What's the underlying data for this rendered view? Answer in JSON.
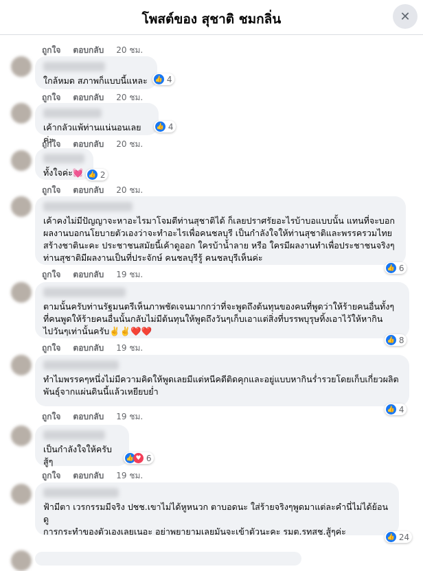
{
  "header": {
    "title": "โพสต์ของ สุชาติ ชมกลิ่น",
    "close_icon": "close-icon"
  },
  "actions": {
    "like_label": "ถูกใจ",
    "reply_label": "ตอบกลับ"
  },
  "top_row": {
    "time": "20 ชม."
  },
  "comments": [
    {
      "text": "ใกล้หมด สภาพก็แบบนี้แหละ",
      "reactions": "4",
      "time": "20 ชม."
    },
    {
      "text": "เค้ากลัวแพ้ท่านแน่นอนเลยค่ะ",
      "reactions": "4",
      "time": "20 ชม."
    },
    {
      "text": "ทั้งใจค่ะ💓",
      "reactions": "2",
      "time": "20 ชม."
    },
    {
      "text": "เค้าคงไม่มีปัญญาจะหาอะไรมาโจมตีท่านสุชาติได้ ก็เลยปราศรัยอะไรบ้าบอแบบนั้น แทนที่จะบอก\nผลงานบอกนโยบายตัวเองว่าจะทำอะไรเพื่อคนชลบุรี เป็นกำลังใจให้ท่านสุชาติและพรรครวมไทย\nสร้างชาตินะคะ ประชาชนสมัยนี้เค้าดูออก ใครบ้าน้ำลาย หรือ ใครมีผลงานทำเพื่อประชาชนจริงๆ\nท่านสุชาติมีผลงานเป็นที่ประจักษ์ คนชลบุรีรู้ คนชลบุรีเห็นค่ะ",
      "reactions": "6",
      "time": "19 ชม."
    },
    {
      "text": "ตามนั้นครับท่านรัฐมนตรีเห็นภาพชัดเจนมากกว่าที่จะพูดถึงต้นทุนของคนที่พูดว่าให้ร้ายคนอื่นทั้งๆ\nที่คนพูดให้ร้ายคนอื่นนั้นกลับไม่มีต้นทุนให้พูดถึงวันๆเก็บเอาแต่สิ่งที่บรรพบุรุษทิ้งเอาไว้ให้หากิน\nไปวันๆเท่านั้นครับ✌️✌️❤️❤️",
      "reactions": "8",
      "time": "19 ชม."
    },
    {
      "text": "ทำไมพรรคๆหนึ่งไม่มีความคิดให้พูดเลยมีแต่หนีคดีติดคุกและอยู่แบบหากินร่ำรวยโดยเก็บเกี่ยวผลิต\nพันธุ์จากแผ่นดินนี้แล้วเหยียบย่ำ",
      "reactions": "4",
      "time": "19 ชม."
    },
    {
      "text": "เป็นกำลังใจให้ครับสู้ๆ",
      "reactions": "6",
      "time": "19 ชม."
    },
    {
      "text": "ฟ้ามีตา เวรกรรมมีจริง ปชช.เขาไม่ได้หูหนวก ตาบอดนะ ใส่ร้ายจริงๆพูดมาแต่ละคำนี่ไม่ได้ย้อนดู\nการกระทำของตัวเองเลยเนอะ อย่าพยายามเลยมันจะเข้าตัวนะคะ รมต.รทสช.สู้ๆค่ะ",
      "reactions": "24",
      "time": ""
    }
  ]
}
